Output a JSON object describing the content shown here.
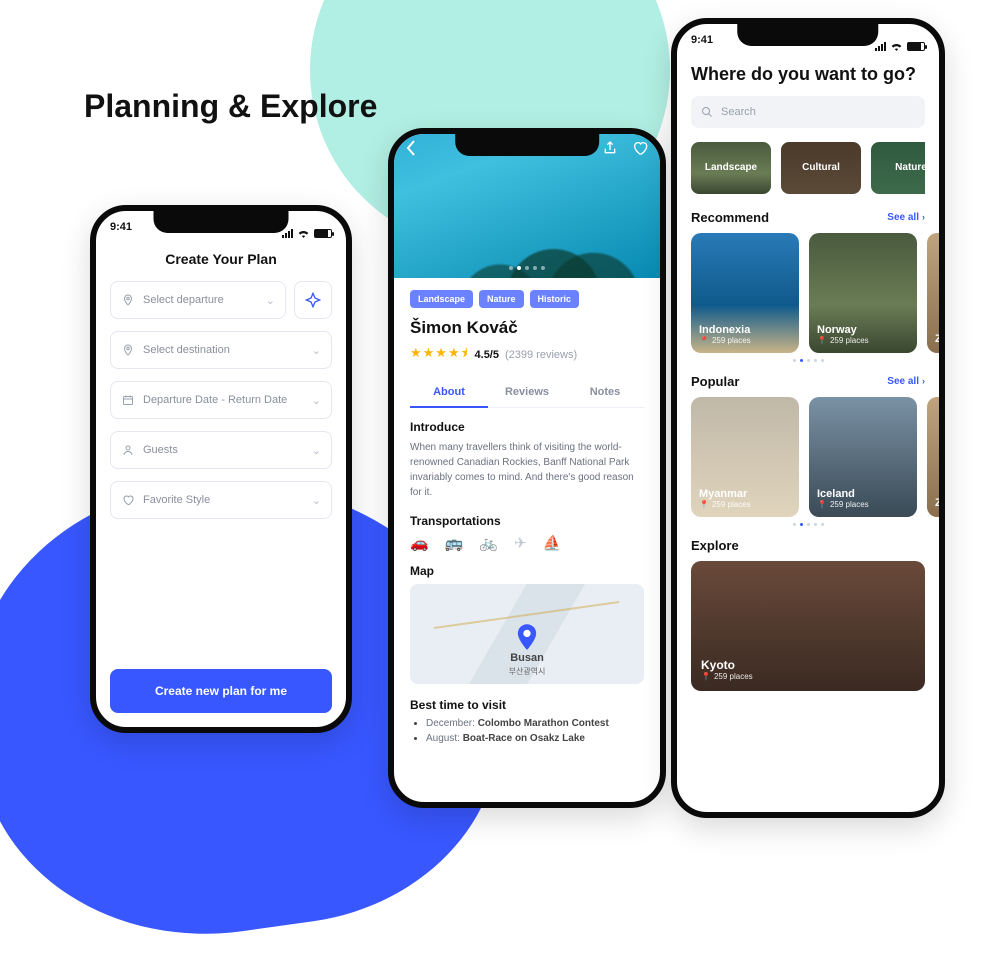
{
  "page": {
    "title": "Planning & Explore"
  },
  "status": {
    "time": "9:41"
  },
  "colors": {
    "accent": "#3857ff",
    "teal": "#7de2d1",
    "star": "#ffb400"
  },
  "phone1": {
    "title": "Create Your Plan",
    "fields": {
      "departure": "Select departure",
      "destination": "Select destination",
      "dates": "Departure Date - Return Date",
      "guests": "Guests",
      "style": "Favorite Style"
    },
    "cta": "Create new plan for me"
  },
  "phone2": {
    "tags": [
      "Landscape",
      "Nature",
      "Historic"
    ],
    "name": "Šimon Kováč",
    "rating": "4.5/5",
    "reviews": "(2399 reviews)",
    "tabs": [
      "About",
      "Reviews",
      "Notes"
    ],
    "intro_h": "Introduce",
    "intro": "When many travellers think of visiting the world-renowned Canadian Rockies, Banff National Park invariably comes to mind. And there's good reason for it.",
    "trans_h": "Transportations",
    "map_h": "Map",
    "map_city": "Busan",
    "map_sub": "부산광역시",
    "best_h": "Best time to visit",
    "best": [
      {
        "month": "December:",
        "event": "Colombo Marathon Contest"
      },
      {
        "month": "August:",
        "event": "Boat-Race on Osakz Lake"
      }
    ]
  },
  "phone3": {
    "heading": "Where do you want to go?",
    "search_placeholder": "Search",
    "categories": [
      "Landscape",
      "Cultural",
      "Nature"
    ],
    "recommend_h": "Recommend",
    "popular_h": "Popular",
    "explore_h": "Explore",
    "see_all": "See all",
    "recommend": [
      {
        "title": "Indonexia",
        "sub": "259 places"
      },
      {
        "title": "Norway",
        "sub": "259 places"
      },
      {
        "title": "Z",
        "sub": ""
      }
    ],
    "popular": [
      {
        "title": "Myanmar",
        "sub": "259 places"
      },
      {
        "title": "Iceland",
        "sub": "259 places"
      },
      {
        "title": "Z",
        "sub": ""
      }
    ],
    "explore": {
      "title": "Kyoto",
      "sub": "259 places"
    }
  }
}
